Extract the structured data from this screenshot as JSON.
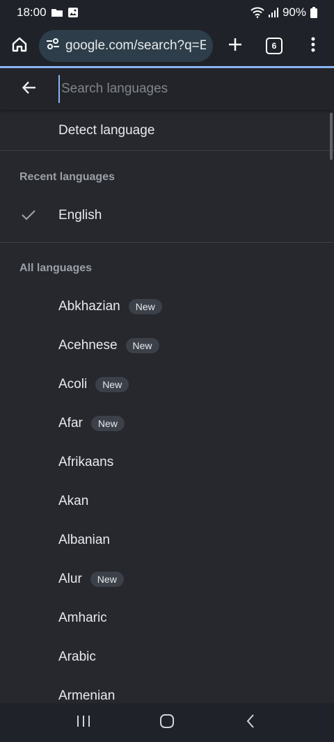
{
  "status_bar": {
    "time": "18:00",
    "battery": "90%"
  },
  "browser": {
    "url": "google.com/search?q=E",
    "tab_count": "6"
  },
  "search": {
    "placeholder": "Search languages"
  },
  "detect": {
    "label": "Detect language"
  },
  "recent": {
    "header": "Recent languages",
    "items": [
      {
        "label": "English",
        "checked": true
      }
    ]
  },
  "all": {
    "header": "All languages",
    "badge_text": "New",
    "items": [
      {
        "label": "Abkhazian",
        "new": true
      },
      {
        "label": "Acehnese",
        "new": true
      },
      {
        "label": "Acoli",
        "new": true
      },
      {
        "label": "Afar",
        "new": true
      },
      {
        "label": "Afrikaans",
        "new": false
      },
      {
        "label": "Akan",
        "new": false
      },
      {
        "label": "Albanian",
        "new": false
      },
      {
        "label": "Alur",
        "new": true
      },
      {
        "label": "Amharic",
        "new": false
      },
      {
        "label": "Arabic",
        "new": false
      },
      {
        "label": "Armenian",
        "new": false
      }
    ]
  },
  "icons": {
    "home": "home-icon",
    "site_info": "tune-icon",
    "add_tab": "plus-icon",
    "menu": "more-vert-icon",
    "back": "arrow-back-icon",
    "check": "check-icon",
    "recents": "recent-apps-icon",
    "home_nav": "home-nav-icon",
    "back_nav": "back-nav-icon"
  },
  "colors": {
    "accent": "#8ab4f8",
    "background": "#26282e",
    "badge": "#3c4049"
  }
}
